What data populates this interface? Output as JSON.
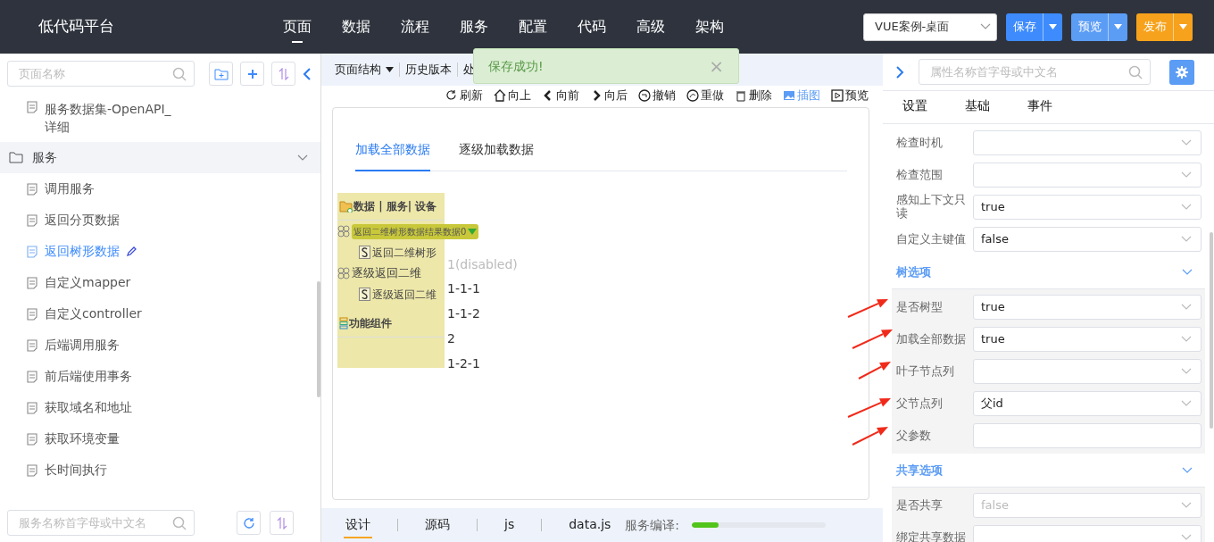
{
  "app": {
    "title": "低代码平台"
  },
  "nav": [
    {
      "label": "页面",
      "selected": true
    },
    {
      "label": "数据",
      "selected": false
    },
    {
      "label": "流程",
      "selected": false
    },
    {
      "label": "服务",
      "selected": false
    },
    {
      "label": "配置",
      "selected": false
    },
    {
      "label": "代码",
      "selected": false
    },
    {
      "label": "高级",
      "selected": false
    },
    {
      "label": "架构",
      "selected": false
    }
  ],
  "project_select": {
    "value": "VUE案例-桌面"
  },
  "header_buttons": [
    {
      "label": "保存",
      "kind": "primary"
    },
    {
      "label": "预览",
      "kind": "light"
    },
    {
      "label": "发布",
      "kind": "warning"
    }
  ],
  "sidebar": {
    "search": {
      "placeholder": "页面名称"
    },
    "items": [
      {
        "label": "服务数据集-OpenAPI_详细",
        "kind": "page",
        "selected": false
      },
      {
        "label": "服务",
        "kind": "folder",
        "expanded": true,
        "selected": false,
        "children": [
          {
            "label": "调用服务",
            "kind": "page",
            "selected": false
          },
          {
            "label": "返回分页数据",
            "kind": "page",
            "selected": false
          },
          {
            "label": "返回树形数据",
            "kind": "page",
            "selected": true
          },
          {
            "label": "自定义mapper",
            "kind": "page",
            "selected": false
          },
          {
            "label": "自定义controller",
            "kind": "page",
            "selected": false
          },
          {
            "label": "后端调用服务",
            "kind": "page",
            "selected": false
          },
          {
            "label": "前后端使用事务",
            "kind": "page",
            "selected": false
          },
          {
            "label": "获取域名和地址",
            "kind": "page",
            "selected": false
          },
          {
            "label": "获取环境变量",
            "kind": "page",
            "selected": false
          },
          {
            "label": "长时间执行",
            "kind": "page",
            "selected": false
          }
        ]
      }
    ],
    "bottom_search": {
      "placeholder": "服务名称首字母或中文名"
    }
  },
  "editor": {
    "menu": [
      "页面结构",
      "历史版本",
      "处"
    ],
    "toast": {
      "message": "保存成功!",
      "close": "×"
    },
    "actions": [
      {
        "label": "刷新",
        "kind": "refresh",
        "selected": false
      },
      {
        "label": "向上",
        "kind": "up",
        "selected": false
      },
      {
        "label": "向前",
        "kind": "prev",
        "selected": false
      },
      {
        "label": "向后",
        "kind": "next",
        "selected": false
      },
      {
        "label": "撤销",
        "kind": "undo",
        "selected": false
      },
      {
        "label": "重做",
        "kind": "redo",
        "selected": false
      },
      {
        "label": "删除",
        "kind": "delete",
        "selected": false
      },
      {
        "label": "插图",
        "kind": "image",
        "selected": true
      },
      {
        "label": "预览",
        "kind": "preview",
        "selected": false
      }
    ],
    "tabs": [
      {
        "label": "加载全部数据",
        "selected": true
      },
      {
        "label": "逐级加载数据",
        "selected": false
      }
    ],
    "tree_fragments": [
      {
        "label": "1(disabled)",
        "disabled": true
      },
      {
        "label": "1-1-1",
        "disabled": false
      },
      {
        "label": "1-1-2",
        "disabled": false
      },
      {
        "label": "2",
        "disabled": false
      },
      {
        "label": "1-2-1",
        "disabled": false
      }
    ],
    "data_panel": {
      "header": "数据 | 服务| 设备",
      "items": [
        {
          "label": "返回二维树形数据结果数据0",
          "kind": "dataset",
          "selected": true
        },
        {
          "label": "返回二维树形",
          "kind": "service",
          "selected": false
        },
        {
          "label": "逐级返回二维",
          "kind": "dataset",
          "selected": false
        },
        {
          "label": "逐级返回二维",
          "kind": "service",
          "selected": false
        }
      ],
      "footer": "功能组件"
    },
    "bottom_tabs": [
      {
        "label": "设计",
        "selected": true
      },
      {
        "label": "源码",
        "selected": false
      },
      {
        "label": "js",
        "selected": false
      },
      {
        "label": "data.js",
        "selected": false
      }
    ],
    "compile": {
      "label": "服务编译:",
      "level": 0.2
    }
  },
  "properties": {
    "search": {
      "placeholder": "属性名称首字母或中文名"
    },
    "tabs": [
      {
        "label": "设置",
        "selected": false
      },
      {
        "label": "基础",
        "selected": false
      },
      {
        "label": "事件",
        "selected": false
      }
    ],
    "rows": [
      {
        "label": "检查时机",
        "kind": "select",
        "value": ""
      },
      {
        "label": "检查范围",
        "kind": "select",
        "value": ""
      },
      {
        "label": "感知上下文只读",
        "kind": "select",
        "value": "true"
      },
      {
        "label": "自定义主键值",
        "kind": "select",
        "value": "false"
      }
    ],
    "sections": [
      {
        "title": "树选项",
        "expanded": true,
        "rows": [
          {
            "label": "是否树型",
            "kind": "select",
            "value": "true",
            "disabled": false
          },
          {
            "label": "加载全部数据",
            "kind": "select",
            "value": "true",
            "disabled": false
          },
          {
            "label": "叶子节点列",
            "kind": "select",
            "value": "",
            "disabled": false
          },
          {
            "label": "父节点列",
            "kind": "select",
            "value": "父id",
            "disabled": false
          },
          {
            "label": "父参数",
            "kind": "input",
            "value": "",
            "disabled": false
          }
        ]
      },
      {
        "title": "共享选项",
        "expanded": true,
        "rows": [
          {
            "label": "是否共享",
            "kind": "select",
            "value": "false",
            "disabled": true
          },
          {
            "label": "绑定共享数据",
            "kind": "select",
            "value": "",
            "disabled": false
          }
        ]
      }
    ]
  }
}
